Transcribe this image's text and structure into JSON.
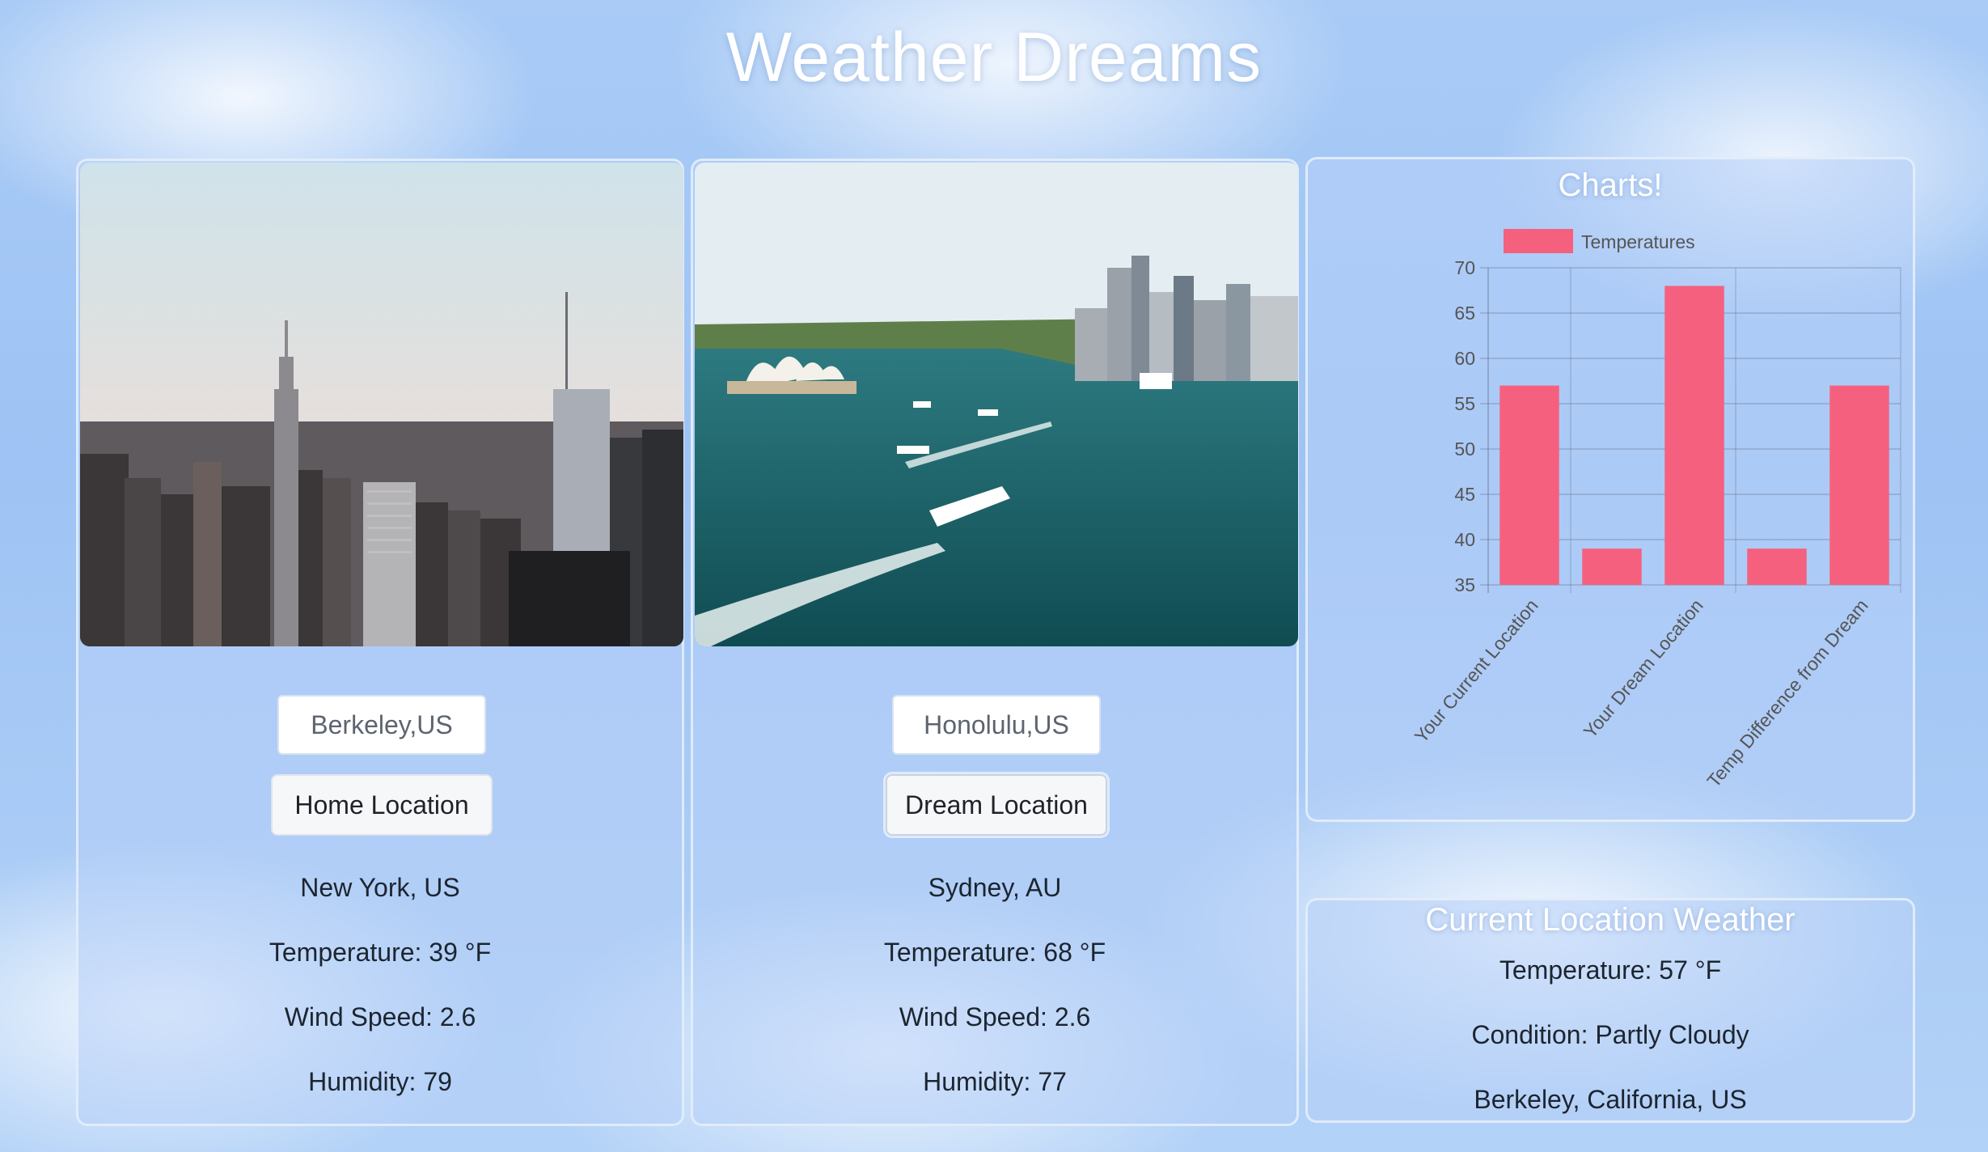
{
  "app": {
    "title": "Weather Dreams"
  },
  "home": {
    "input_value": "Berkeley,US",
    "button_label": "Home Location",
    "city": "New York, US",
    "temperature": "Temperature: 39 °F",
    "wind": "Wind Speed: 2.6",
    "humidity": "Humidity: 79"
  },
  "dream": {
    "input_value": "Honolulu,US",
    "button_label": "Dream Location",
    "city": "Sydney, AU",
    "temperature": "Temperature: 68 °F",
    "wind": "Wind Speed: 2.6",
    "humidity": "Humidity: 77"
  },
  "chart_panel": {
    "title": "Charts!"
  },
  "chart_data": {
    "type": "bar",
    "categories": [
      "Your Current Location",
      "",
      "Your Dream Location",
      "",
      "Temp Difference from Dream"
    ],
    "series": [
      {
        "name": "Temperatures",
        "values": [
          57,
          39,
          68,
          39,
          57
        ],
        "color": "#f5607f"
      }
    ],
    "ylim": [
      35,
      70
    ],
    "yticks": [
      "35",
      "40",
      "45",
      "50",
      "55",
      "60",
      "65",
      "70"
    ],
    "grid": true,
    "legend": "top"
  },
  "current": {
    "title": "Current Location Weather",
    "temperature": "Temperature: 57 °F",
    "condition": "Condition: Partly Cloudy",
    "location": "Berkeley, California, US"
  }
}
